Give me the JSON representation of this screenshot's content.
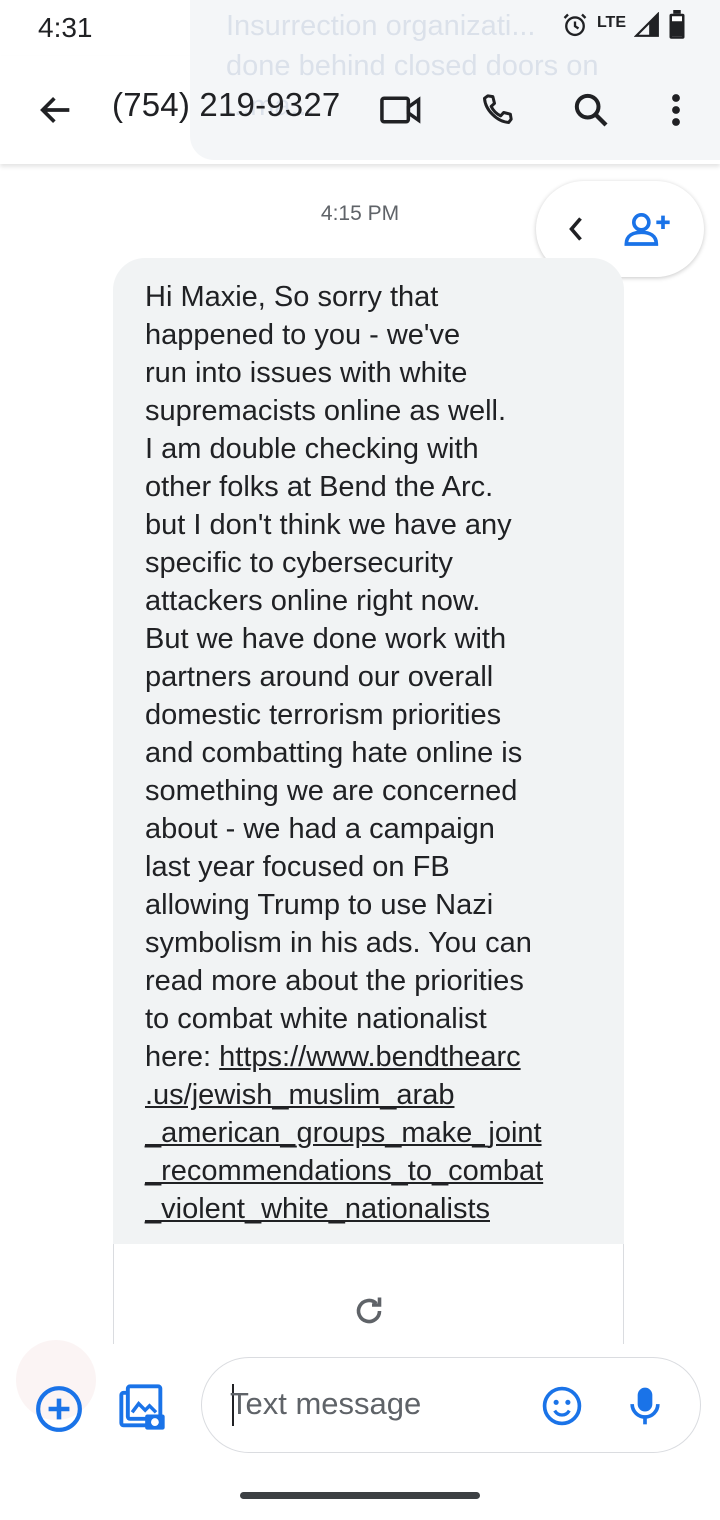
{
  "status_bar": {
    "time": "4:31",
    "network_label": "LTE",
    "icons": [
      "alarm-icon",
      "signal-icon",
      "battery-icon"
    ]
  },
  "notification_ghost": {
    "text": "Insurrection organizati...\ndone behind closed doors on\n...ma..."
  },
  "header": {
    "title": "(754) 219-9327",
    "icons": [
      "back-arrow-icon",
      "video-call-icon",
      "phone-icon",
      "search-icon",
      "more-vert-icon"
    ]
  },
  "floating_actions": {
    "icons": [
      "chevron-left-icon",
      "add-contact-icon"
    ]
  },
  "conversation": {
    "timestamp": "4:15 PM",
    "message": {
      "body": "Hi Maxie, So sorry that\nhappened to you - we've\nrun into issues with white\nsupremacists online as well.\nI am double checking with\nother folks at Bend the Arc.\nbut I don't think we have any\nspecific to cybersecurity\nattackers online right now.\nBut we have done work with\npartners around our overall\ndomestic terrorism priorities\nand combatting hate online is\nsomething we are concerned\nabout - we had a campaign\nlast year focused on FB\nallowing Trump to use Nazi\nsymbolism in his ads. You can\nread more about the priorities\nto combat white nationalist\nhere: ",
      "link": "https://www.bendthearc\n.us/jewish_muslim_arab\n_american_groups_make_joint\n_recommendations_to_combat\n_violent_white_nationalists"
    },
    "preview_icon": "refresh-icon"
  },
  "compose": {
    "placeholder": "Text message",
    "icons": [
      "add-circle-icon",
      "gallery-icon",
      "emoji-icon",
      "mic-icon"
    ]
  },
  "colors": {
    "accent": "#1a73e8",
    "bubble": "#f1f3f4",
    "text": "#202124",
    "secondary_text": "#5f6368"
  }
}
